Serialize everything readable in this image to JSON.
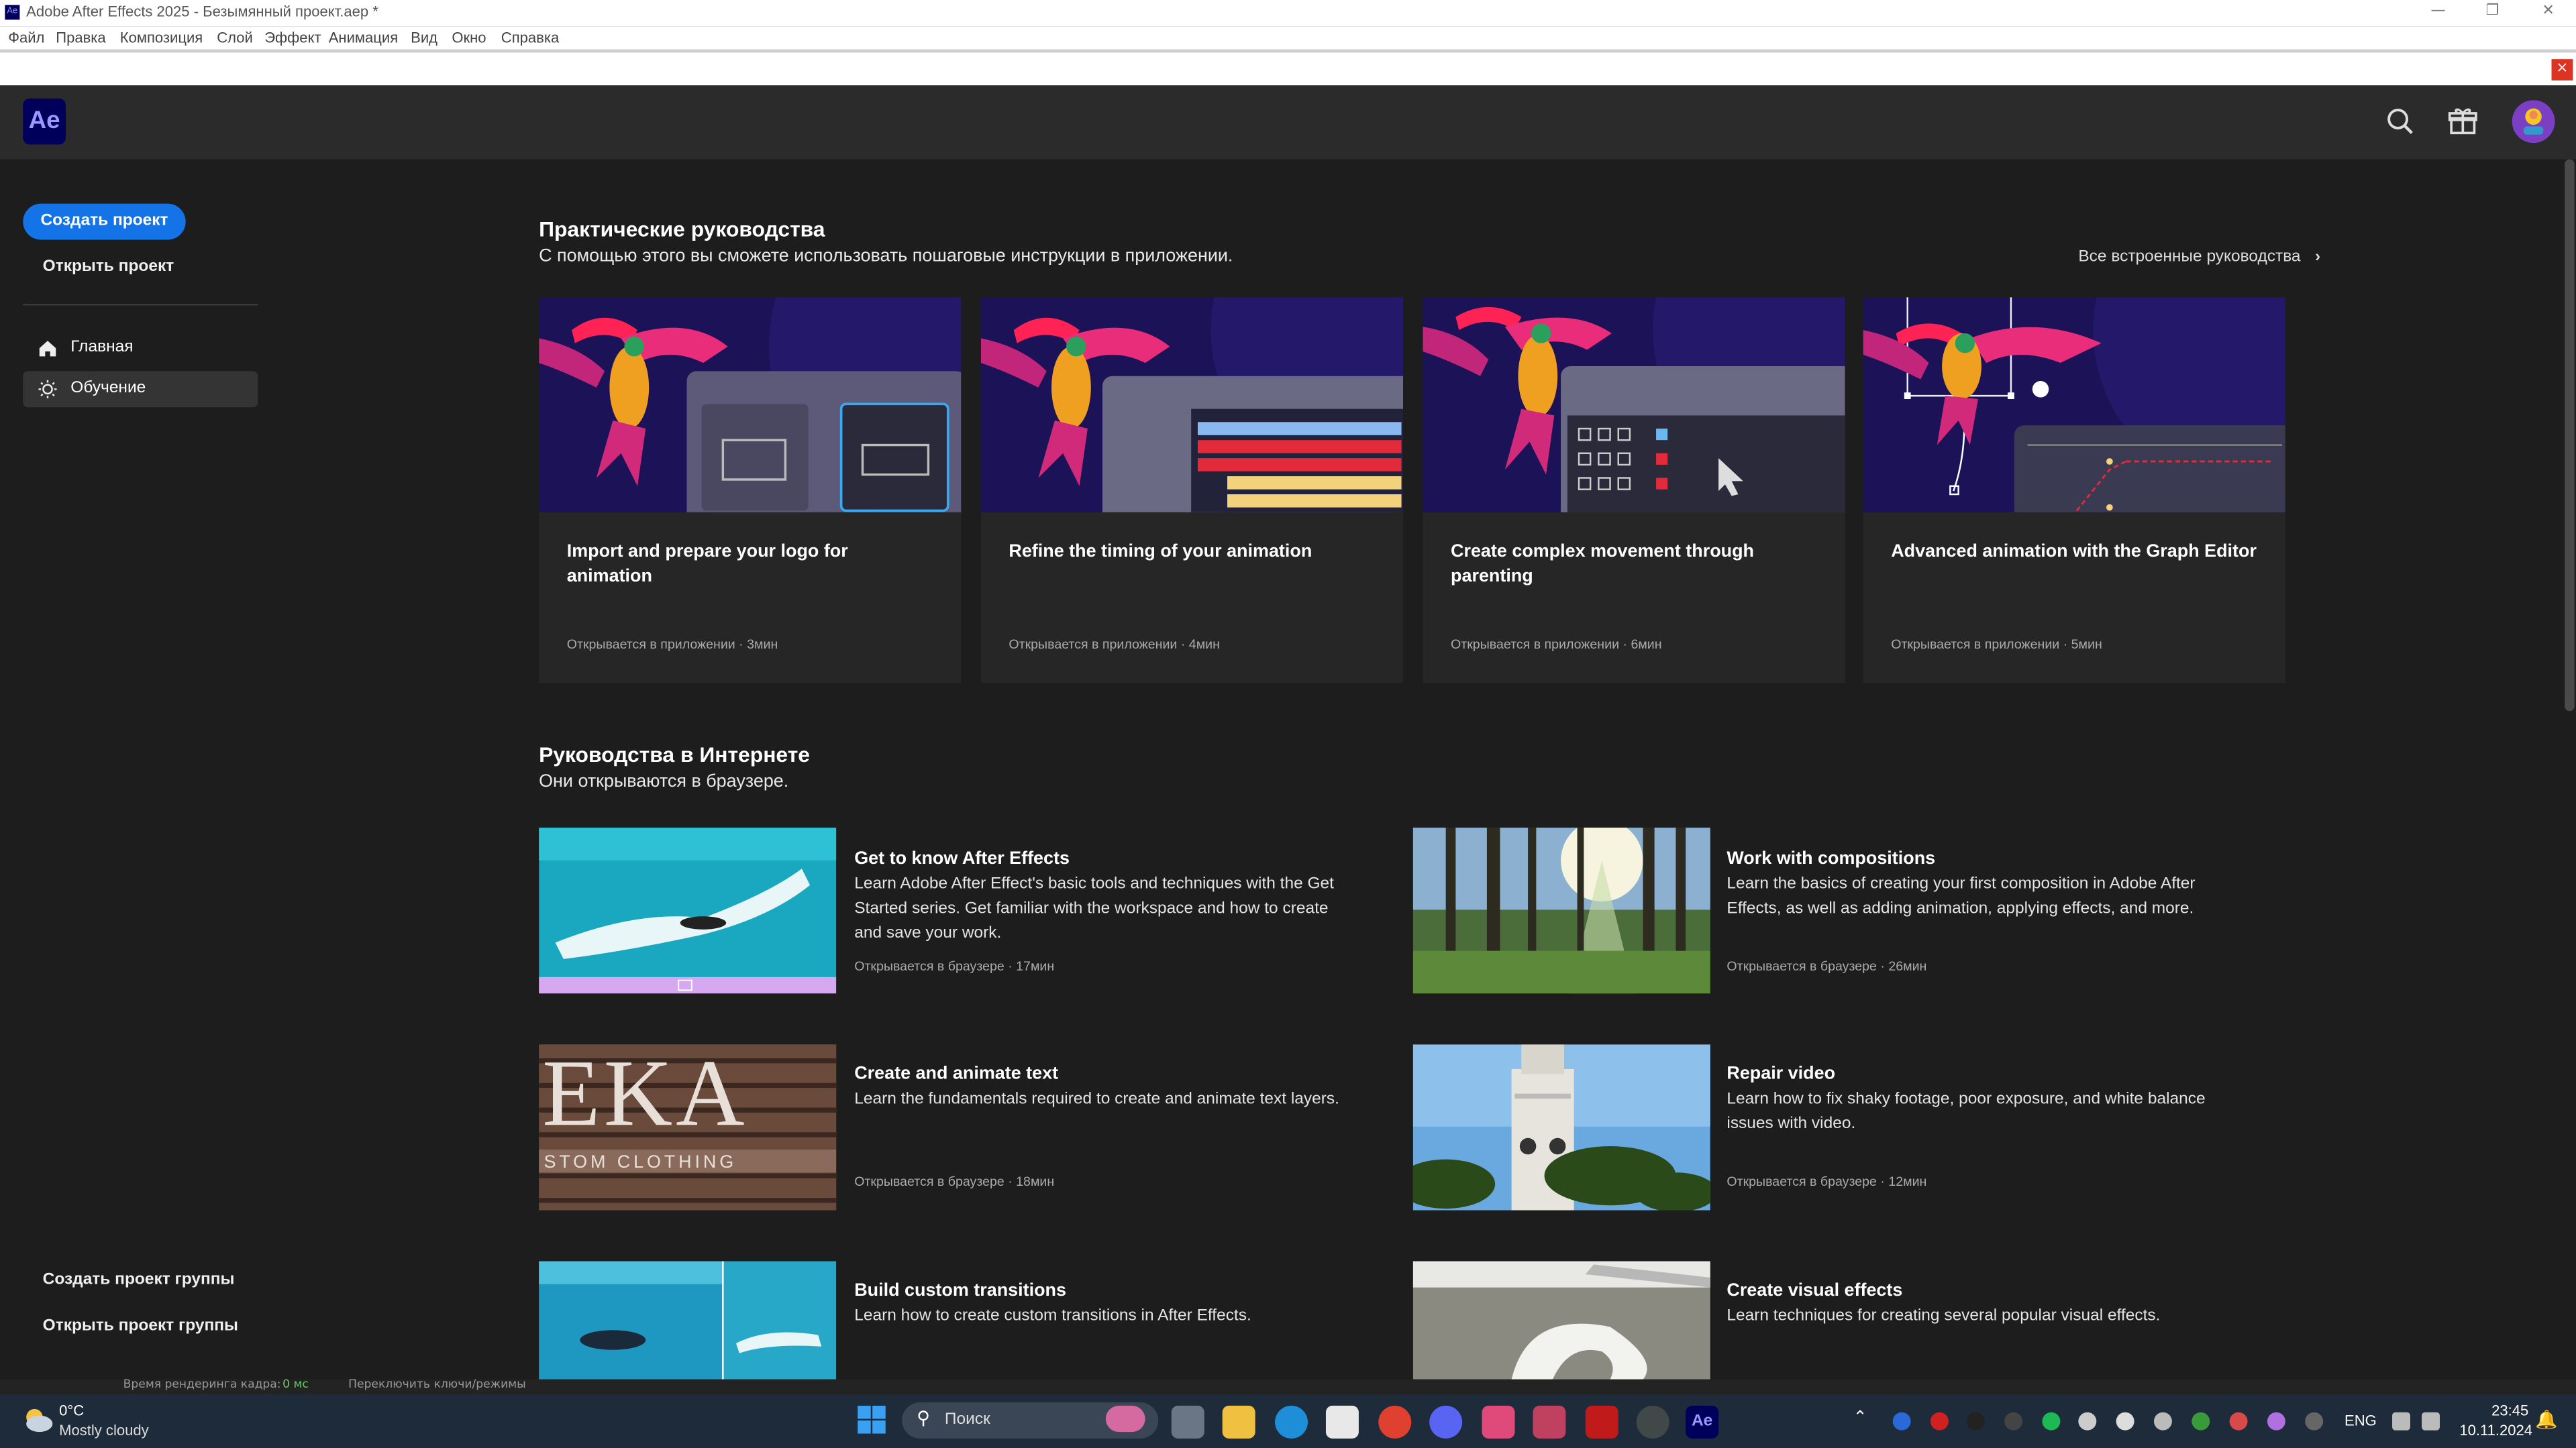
{
  "window": {
    "title": "Adobe After Effects 2025 - Безымянный проект.aep *",
    "app_icon": "Ae"
  },
  "menu": [
    "Файл",
    "Правка",
    "Композиция",
    "Слой",
    "Эффект",
    "Анимация",
    "Вид",
    "Окно",
    "Справка"
  ],
  "header": {
    "logo": "Ae",
    "icons": [
      "search-icon",
      "gift-icon",
      "avatar"
    ]
  },
  "sidebar": {
    "create_label": "Создать проект",
    "open_label": "Открыть проект",
    "nav": [
      {
        "label": "Главная",
        "icon": "home-icon"
      },
      {
        "label": "Обучение",
        "icon": "lightbulb-icon",
        "active": true
      }
    ],
    "team_create": "Создать проект группы",
    "team_open": "Открыть проект группы"
  },
  "inapp": {
    "title": "Практические руководства",
    "subtitle": "С помощью этого вы сможете использовать пошаговые инструкции в приложении.",
    "all_link": "Все встроенные руководства",
    "cards": [
      {
        "title": "Import and prepare your logo for animation",
        "meta": "Открывается в приложении",
        "duration": "3мин"
      },
      {
        "title": "Refine the timing of your animation",
        "meta": "Открывается в приложении",
        "duration": "4мин"
      },
      {
        "title": "Create complex movement through parenting",
        "meta": "Открывается в приложении",
        "duration": "6мин"
      },
      {
        "title": "Advanced animation with the Graph Editor",
        "meta": "Открывается в приложении",
        "duration": "5мин"
      }
    ]
  },
  "web": {
    "title": "Руководства в Интернете",
    "subtitle": "Они открываются в браузере.",
    "items": [
      {
        "title": "Get to know After Effects",
        "desc": "Learn Adobe After Effect's basic tools and techniques with the Get Started series. Get familiar with the workspace and how to create and save your work.",
        "meta": "Открывается в браузере",
        "duration": "17мин"
      },
      {
        "title": "Work with compositions",
        "desc": "Learn the basics of creating your first composition in Adobe After Effects, as well as adding animation, applying effects, and more.",
        "meta": "Открывается в браузере",
        "duration": "26мин"
      },
      {
        "title": "Create and animate text",
        "desc": "Learn the fundamentals required to create and animate text layers.",
        "meta": "Открывается в браузере",
        "duration": "18мин"
      },
      {
        "title": "Repair video",
        "desc": "Learn how to fix shaky footage, poor exposure, and white balance issues with video.",
        "meta": "Открывается в браузере",
        "duration": "12мин"
      },
      {
        "title": "Build custom transitions",
        "desc": "Learn how to create custom transitions in After Effects.",
        "meta": "",
        "duration": ""
      },
      {
        "title": "Create visual effects",
        "desc": "Learn techniques for creating several popular visual effects.",
        "meta": "",
        "duration": ""
      }
    ],
    "thumb_text": {
      "ekka": "EKA",
      "clothing": "STOM CLOTHING"
    }
  },
  "taskbar": {
    "weather_temp": "0°C",
    "weather_desc": "Mostly cloudy",
    "search_placeholder": "Поиск",
    "lang": "ENG",
    "time": "23:45",
    "date": "10.11.2024"
  },
  "statusline": {
    "left": "Время рендеринга кадра:",
    "value": "0 мс",
    "right": "Переключить ключи/режимы"
  },
  "colors": {
    "accent": "#1473e6",
    "ae_logo_bg": "#00005b",
    "ae_logo_fg": "#9999ff",
    "bg": "#1d1d1d",
    "card_bg": "#262626"
  }
}
